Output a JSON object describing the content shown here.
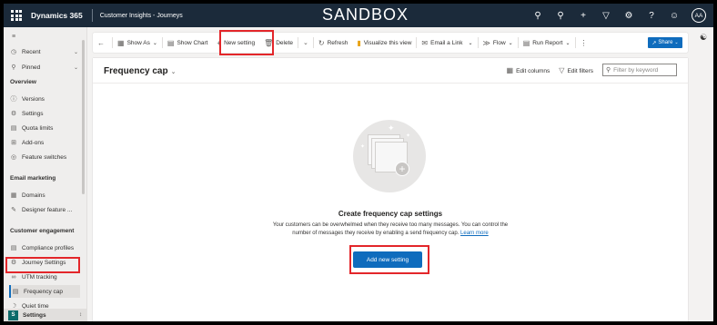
{
  "topbar": {
    "brand": "Dynamics 365",
    "app_name": "Customer Insights - Journeys",
    "environment_banner": "SANDBOX",
    "icons": [
      "search-icon",
      "lightbulb-icon",
      "plus-icon",
      "filter-icon",
      "settings-icon",
      "help-icon",
      "chat-icon"
    ],
    "avatar_initials": "AA"
  },
  "sidebar": {
    "nav": [
      {
        "label": "Recent",
        "icon": "clock-icon"
      },
      {
        "label": "Pinned",
        "icon": "pin-icon"
      }
    ],
    "sections": [
      {
        "heading": "Overview",
        "items": [
          {
            "label": "Versions",
            "icon": "info-icon"
          },
          {
            "label": "Settings",
            "icon": "gear-icon"
          },
          {
            "label": "Quota limits",
            "icon": "quota-icon"
          },
          {
            "label": "Add-ons",
            "icon": "addon-icon"
          },
          {
            "label": "Feature switches",
            "icon": "toggle-icon"
          }
        ]
      },
      {
        "heading": "Email marketing",
        "items": [
          {
            "label": "Domains",
            "icon": "domain-icon"
          },
          {
            "label": "Designer feature ...",
            "icon": "designer-icon"
          }
        ]
      },
      {
        "heading": "Customer engagement",
        "items": [
          {
            "label": "Compliance profiles",
            "icon": "compliance-icon"
          },
          {
            "label": "Journey Settings",
            "icon": "journey-icon"
          },
          {
            "label": "UTM tracking",
            "icon": "link-icon"
          },
          {
            "label": "Frequency cap",
            "icon": "frequency-icon"
          },
          {
            "label": "Quiet time",
            "icon": "quiet-icon"
          }
        ]
      }
    ],
    "area": {
      "badge": "S",
      "label": "Settings"
    }
  },
  "commandbar": {
    "back": "←",
    "show_as": "Show As",
    "show_chart": "Show Chart",
    "new_setting": "New setting",
    "delete": "Delete",
    "refresh": "Refresh",
    "visualize": "Visualize this view",
    "email_link": "Email a Link",
    "flow": "Flow",
    "run_report": "Run Report",
    "share": "Share"
  },
  "main": {
    "title": "Frequency cap",
    "edit_columns": "Edit columns",
    "edit_filters": "Edit filters",
    "filter_placeholder": "Filter by keyword",
    "empty_title": "Create frequency cap settings",
    "empty_desc_1": "Your customers can be overwhelmed when they receive too many messages. You can control the number of messages they receive by enabling a send frequency cap.",
    "learn_more": "Learn more",
    "add_button": "Add new setting"
  },
  "colors": {
    "topbar": "#1b2a3a",
    "accent": "#0f6cbd",
    "highlight": "#e3262a"
  }
}
